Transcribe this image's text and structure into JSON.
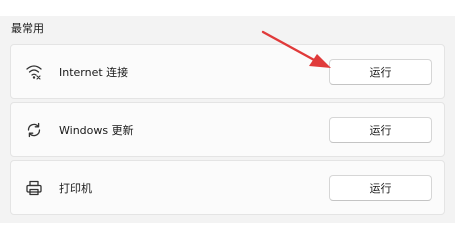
{
  "section": {
    "title": "最常用"
  },
  "items": [
    {
      "label": "Internet 连接",
      "icon": "wifi-icon",
      "button_label": "运行"
    },
    {
      "label": "Windows 更新",
      "icon": "refresh-icon",
      "button_label": "运行"
    },
    {
      "label": "打印机",
      "icon": "printer-icon",
      "button_label": "运行"
    }
  ],
  "colors": {
    "background": "#f3f3f3",
    "card": "#fbfbfb",
    "annotation_arrow": "#e03a3a"
  }
}
